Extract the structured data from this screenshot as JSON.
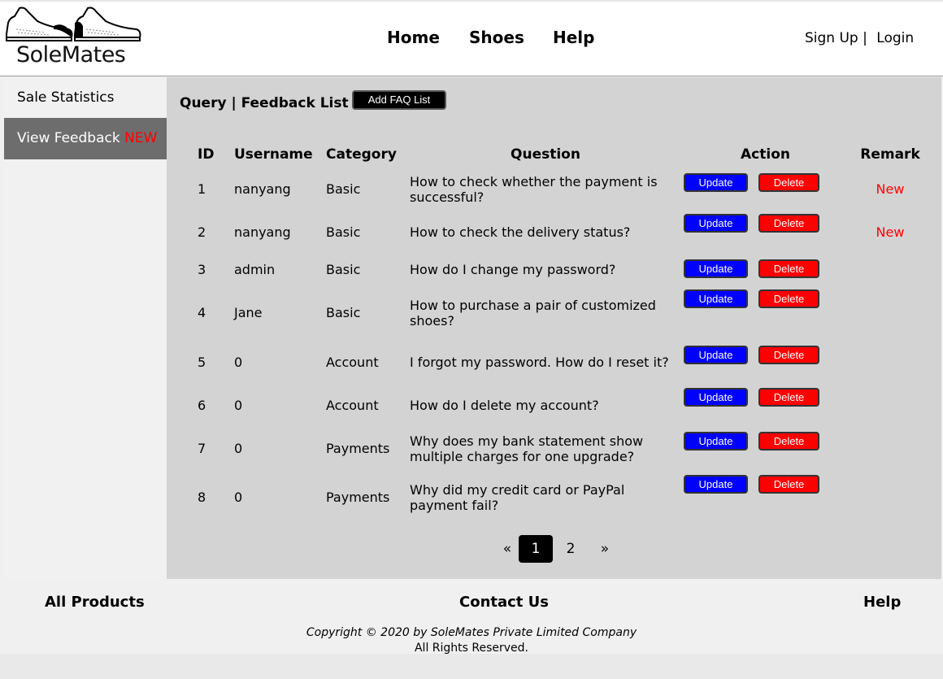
{
  "brand": {
    "name": "SoleMates"
  },
  "nav": {
    "home": "Home",
    "shoes": "Shoes",
    "help": "Help"
  },
  "auth": {
    "signup": "Sign Up",
    "separator": "|",
    "login": "Login"
  },
  "sidebar": {
    "items": [
      {
        "label": "Sale Statistics"
      },
      {
        "label": "View Feedback",
        "badge": "NEW"
      }
    ]
  },
  "content": {
    "title": "Query | Feedback List",
    "add_faq_label": "Add FAQ List",
    "columns": [
      "ID",
      "Username",
      "Category",
      "Question",
      "Action",
      "Remark"
    ],
    "update_label": "Update",
    "delete_label": "Delete",
    "rows": [
      {
        "id": "1",
        "username": "nanyang",
        "category": "Basic",
        "question": "How to check whether the payment is successful?",
        "remark": "New"
      },
      {
        "id": "2",
        "username": "nanyang",
        "category": "Basic",
        "question": "How to check the delivery status?",
        "remark": "New"
      },
      {
        "id": "3",
        "username": "admin",
        "category": "Basic",
        "question": "How do I change my password?",
        "remark": ""
      },
      {
        "id": "4",
        "username": "Jane",
        "category": "Basic",
        "question": "How to purchase a pair of customized shoes?",
        "remark": ""
      },
      {
        "id": "5",
        "username": "0",
        "category": "Account",
        "question": "I forgot my password. How do I reset it?",
        "remark": ""
      },
      {
        "id": "6",
        "username": "0",
        "category": "Account",
        "question": "How do I delete my account?",
        "remark": ""
      },
      {
        "id": "7",
        "username": "0",
        "category": "Payments",
        "question": "Why does my bank statement show multiple charges for one upgrade?",
        "remark": ""
      },
      {
        "id": "8",
        "username": "0",
        "category": "Payments",
        "question": "Why did my credit card or PayPal payment fail?",
        "remark": ""
      }
    ],
    "pager": {
      "prev": "«",
      "current": "1",
      "next_page": "2",
      "next": "»"
    }
  },
  "footer": {
    "all_products": "All Products",
    "contact": "Contact Us",
    "help": "Help",
    "copyright": "Copyright © 2020 by SoleMates Private Limited Company",
    "rights": "All Rights Reserved."
  },
  "colors": {
    "update": "#0000ff",
    "delete": "#ff0000",
    "new": "#ff0000",
    "panel": "#d3d3d3",
    "active_sidebar": "#6d6d6d"
  }
}
